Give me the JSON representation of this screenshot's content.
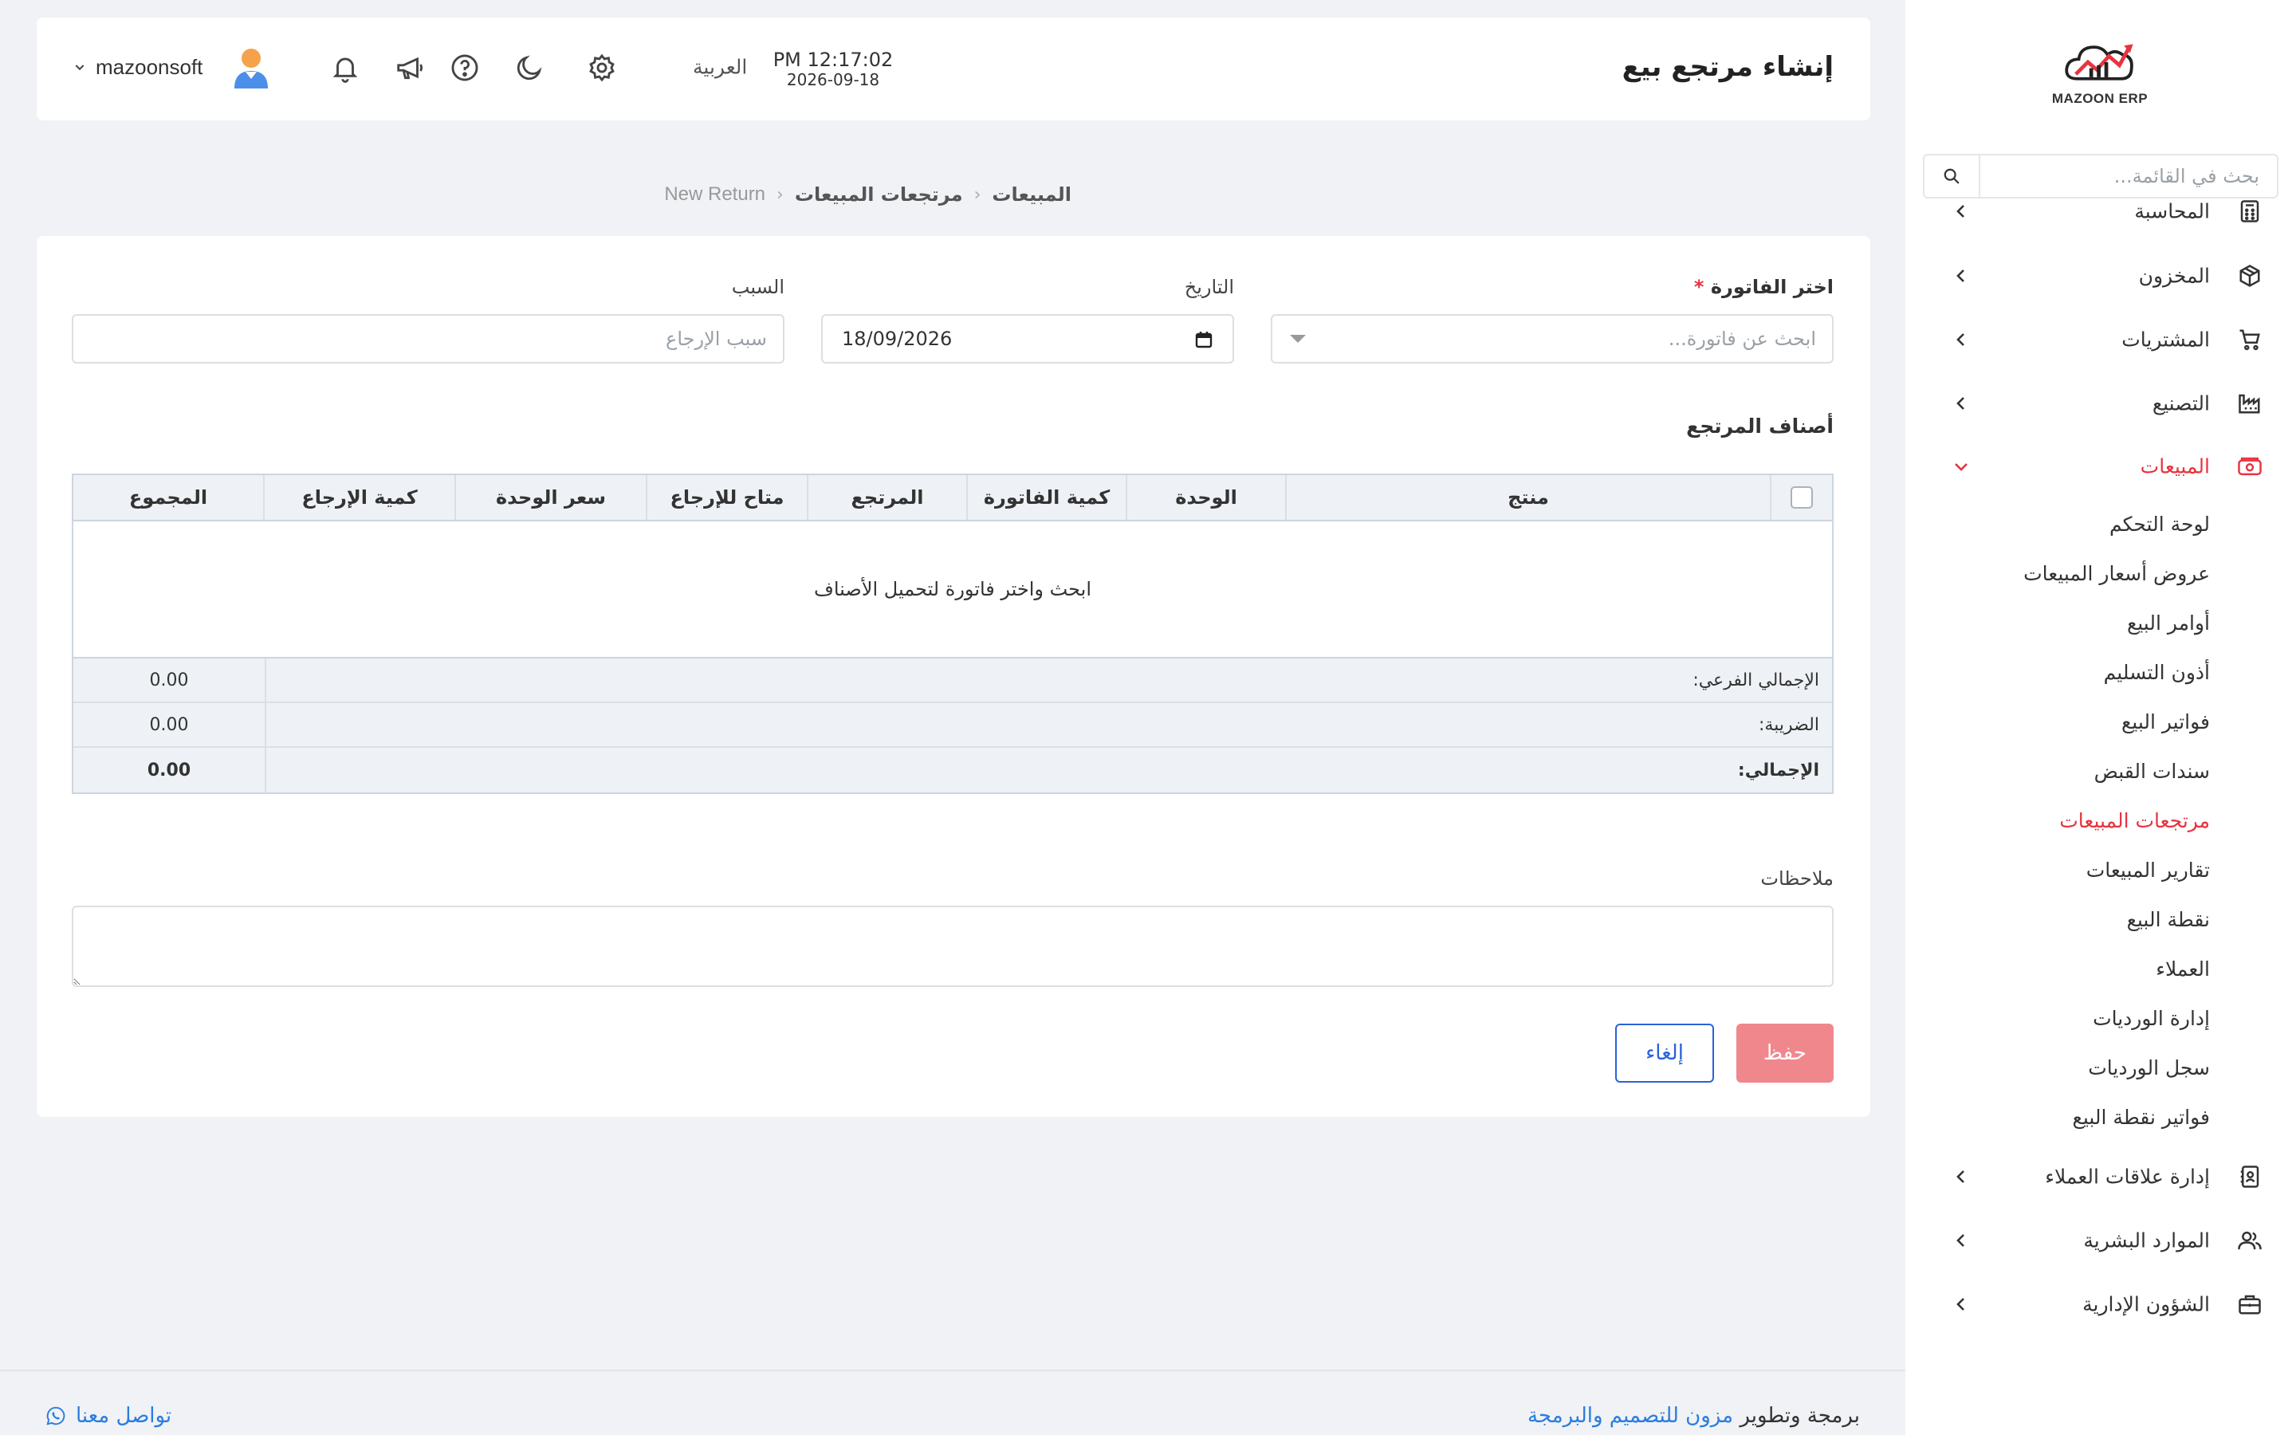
{
  "brand": {
    "logo_text": "MAZOON ERP",
    "accent": "#e8333f",
    "link_color": "#2a7de1"
  },
  "sidebar": {
    "search_placeholder": "بحث في القائمة...",
    "items": [
      {
        "label": "المحاسبة",
        "icon": "calculator-icon"
      },
      {
        "label": "المخزون",
        "icon": "box-icon"
      },
      {
        "label": "المشتريات",
        "icon": "cart-icon"
      },
      {
        "label": "التصنيع",
        "icon": "factory-icon"
      },
      {
        "label": "المبيعات",
        "icon": "sales-icon",
        "active": true
      },
      {
        "label": "إدارة علاقات العملاء",
        "icon": "contacts-icon"
      },
      {
        "label": "الموارد البشرية",
        "icon": "users-icon"
      },
      {
        "label": "الشؤون الإدارية",
        "icon": "briefcase-icon"
      }
    ],
    "sales_sub": [
      "لوحة التحكم",
      "عروض أسعار المبيعات",
      "أوامر البيع",
      "أذون التسليم",
      "فواتير البيع",
      "سندات القبض",
      "مرتجعات المبيعات",
      "تقارير المبيعات",
      "نقطة البيع",
      "العملاء",
      "إدارة الورديات",
      "سجل الورديات",
      "فواتير نقطة البيع"
    ]
  },
  "header": {
    "title": "إنشاء مرتجع بيع",
    "time": "PM 12:17:02",
    "date": "2026-09-18",
    "language": "العربية",
    "username": "mazoonsoft"
  },
  "breadcrumb": [
    "المبيعات",
    "مرتجعات المبيعات",
    "New Return"
  ],
  "form": {
    "invoice_label": "اختر الفاتورة",
    "invoice_required": "*",
    "invoice_placeholder": "ابحث عن فاتورة...",
    "date_label": "التاريخ",
    "date_value": "18/09/2026",
    "reason_label": "السبب",
    "reason_placeholder": "سبب الإرجاع",
    "items_title": "أصناف المرتجع",
    "columns": [
      "منتج",
      "الوحدة",
      "كمية الفاتورة",
      "المرتجع",
      "متاح للإرجاع",
      "سعر الوحدة",
      "كمية الإرجاع",
      "المجموع"
    ],
    "empty_message": "ابحث واختر فاتورة لتحميل الأصناف",
    "totals": [
      {
        "label": "الإجمالي الفرعي:",
        "value": "0.00"
      },
      {
        "label": "الضريبة:",
        "value": "0.00"
      },
      {
        "label": "الإجمالي:",
        "value": "0.00"
      }
    ],
    "notes_label": "ملاحظات",
    "save_label": "حفظ",
    "cancel_label": "إلغاء"
  },
  "footer": {
    "credit_prefix": "برمجة وتطوير",
    "credit_link": "مزون للتصميم والبرمجة",
    "contact": "تواصل معنا"
  }
}
